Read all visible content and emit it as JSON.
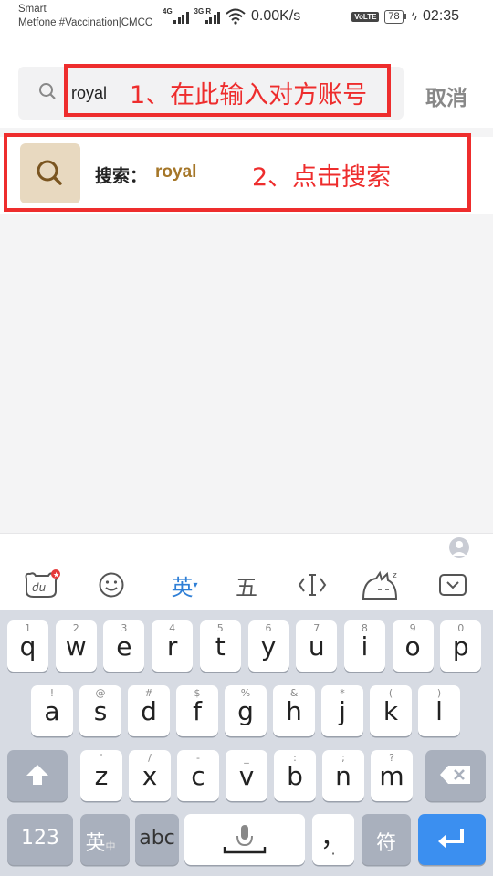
{
  "status_bar": {
    "carrier_line1": "Smart",
    "carrier_line2": "Metfone #Vaccination|CMCC",
    "net1": "4G",
    "net2": "3G R",
    "speed": "0.00K/s",
    "volte": "VoLTE",
    "battery": "78",
    "time": "02:35"
  },
  "search": {
    "value": "royal",
    "cancel_label": "取消"
  },
  "result": {
    "label": "搜索：",
    "term": "royal"
  },
  "annotations": {
    "step1": "1、在此输入对方账号",
    "step2": "2、点击搜索",
    "color": "#ee2d2d"
  },
  "keyboard": {
    "toolbar": {
      "lang_label": "英",
      "wubi_label": "五"
    },
    "row1": [
      {
        "sub": "1",
        "main": "q"
      },
      {
        "sub": "2",
        "main": "w"
      },
      {
        "sub": "3",
        "main": "e"
      },
      {
        "sub": "4",
        "main": "r"
      },
      {
        "sub": "5",
        "main": "t"
      },
      {
        "sub": "6",
        "main": "y"
      },
      {
        "sub": "7",
        "main": "u"
      },
      {
        "sub": "8",
        "main": "i"
      },
      {
        "sub": "9",
        "main": "o"
      },
      {
        "sub": "0",
        "main": "p"
      }
    ],
    "row2": [
      {
        "sub": "!",
        "main": "a"
      },
      {
        "sub": "@",
        "main": "s"
      },
      {
        "sub": "#",
        "main": "d"
      },
      {
        "sub": "$",
        "main": "f"
      },
      {
        "sub": "%",
        "main": "g"
      },
      {
        "sub": "&",
        "main": "h"
      },
      {
        "sub": "*",
        "main": "j"
      },
      {
        "sub": "(",
        "main": "k"
      },
      {
        "sub": ")",
        "main": "l"
      }
    ],
    "row3": [
      {
        "sub": "'",
        "main": "z"
      },
      {
        "sub": "/",
        "main": "x"
      },
      {
        "sub": "-",
        "main": "c"
      },
      {
        "sub": "_",
        "main": "v"
      },
      {
        "sub": ":",
        "main": "b"
      },
      {
        "sub": ";",
        "main": "n"
      },
      {
        "sub": "?",
        "main": "m"
      }
    ],
    "bottom": {
      "num_label": "123",
      "lang_label": "英",
      "lang_sub": "中",
      "abc_label": "abc",
      "comma_label": "，",
      "fu_label": "符"
    }
  }
}
